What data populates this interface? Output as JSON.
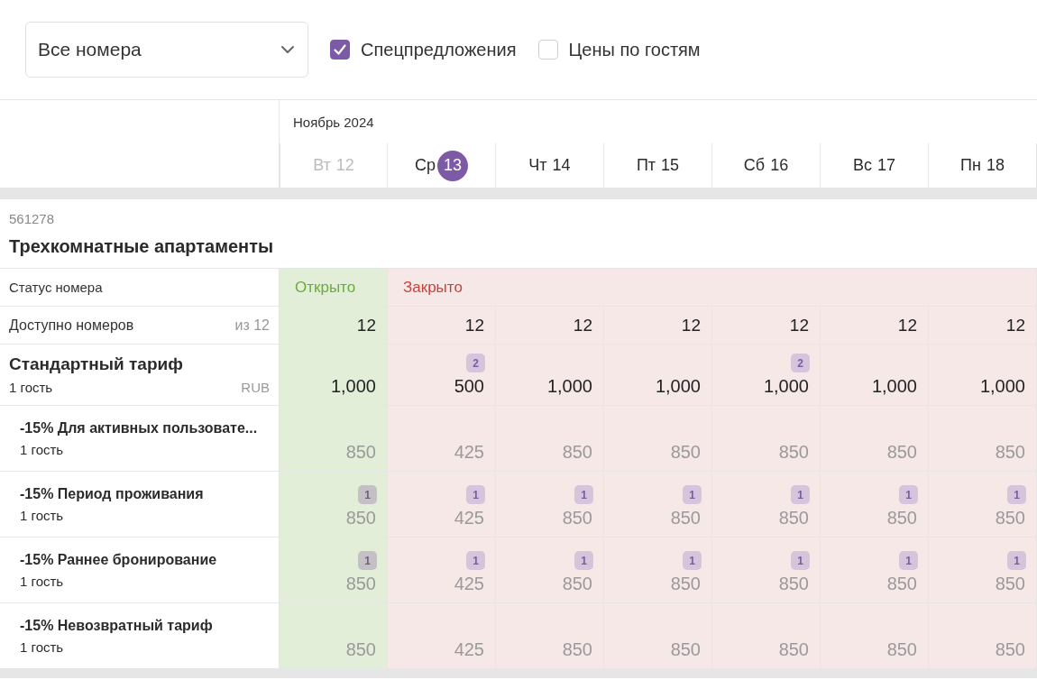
{
  "room_filter": {
    "value": "Все номера"
  },
  "checkboxes": [
    {
      "label": "Спецпредложения",
      "checked": true
    },
    {
      "label": "Цены по гостям",
      "checked": false
    }
  ],
  "calendar": {
    "month": "Ноябрь 2024",
    "days": [
      {
        "weekday": "Вт",
        "day": "12",
        "past": true,
        "today": false,
        "open": true
      },
      {
        "weekday": "Ср",
        "day": "13",
        "past": false,
        "today": true,
        "open": false
      },
      {
        "weekday": "Чт",
        "day": "14",
        "past": false,
        "today": false,
        "open": false
      },
      {
        "weekday": "Пт",
        "day": "15",
        "past": false,
        "today": false,
        "open": false
      },
      {
        "weekday": "Сб",
        "day": "16",
        "past": false,
        "today": false,
        "open": false
      },
      {
        "weekday": "Вс",
        "day": "17",
        "past": false,
        "today": false,
        "open": false
      },
      {
        "weekday": "Пн",
        "day": "18",
        "past": false,
        "today": false,
        "open": false
      }
    ]
  },
  "room": {
    "id": "561278",
    "name": "Трехкомнатные апартаменты",
    "status": {
      "label": "Статус номера",
      "run_labels": [
        "Открыто",
        "Закрыто"
      ]
    },
    "availability": {
      "label": "Доступно номеров",
      "total": "из 12",
      "values": [
        "12",
        "12",
        "12",
        "12",
        "12",
        "12",
        "12"
      ]
    },
    "rates": [
      {
        "kind": "base",
        "name": "Стандартный тариф",
        "guests": "1 гость",
        "currency": "RUB",
        "cells": [
          {
            "price": "1,000"
          },
          {
            "price": "500",
            "badge": "2"
          },
          {
            "price": "1,000"
          },
          {
            "price": "1,000"
          },
          {
            "price": "1,000",
            "badge": "2"
          },
          {
            "price": "1,000"
          },
          {
            "price": "1,000"
          }
        ]
      },
      {
        "kind": "derived",
        "name": "-15% Для активных пользовате...",
        "guests": "1 гость",
        "cells": [
          {
            "price": "850"
          },
          {
            "price": "425"
          },
          {
            "price": "850"
          },
          {
            "price": "850"
          },
          {
            "price": "850"
          },
          {
            "price": "850"
          },
          {
            "price": "850"
          }
        ]
      },
      {
        "kind": "derived",
        "name": "-15% Период проживания",
        "guests": "1 гость",
        "cells": [
          {
            "price": "850",
            "badge": "1"
          },
          {
            "price": "425",
            "badge": "1"
          },
          {
            "price": "850",
            "badge": "1"
          },
          {
            "price": "850",
            "badge": "1"
          },
          {
            "price": "850",
            "badge": "1"
          },
          {
            "price": "850",
            "badge": "1"
          },
          {
            "price": "850",
            "badge": "1"
          }
        ]
      },
      {
        "kind": "derived",
        "name": "-15% Раннее бронирование",
        "guests": "1 гость",
        "cells": [
          {
            "price": "850",
            "badge": "1"
          },
          {
            "price": "425",
            "badge": "1"
          },
          {
            "price": "850",
            "badge": "1"
          },
          {
            "price": "850",
            "badge": "1"
          },
          {
            "price": "850",
            "badge": "1"
          },
          {
            "price": "850",
            "badge": "1"
          },
          {
            "price": "850",
            "badge": "1"
          }
        ]
      },
      {
        "kind": "derived",
        "name": "-15% Невозвратный тариф",
        "guests": "1 гость",
        "cells": [
          {
            "price": "850"
          },
          {
            "price": "425"
          },
          {
            "price": "850"
          },
          {
            "price": "850"
          },
          {
            "price": "850"
          },
          {
            "price": "850"
          },
          {
            "price": "850"
          }
        ]
      }
    ]
  }
}
